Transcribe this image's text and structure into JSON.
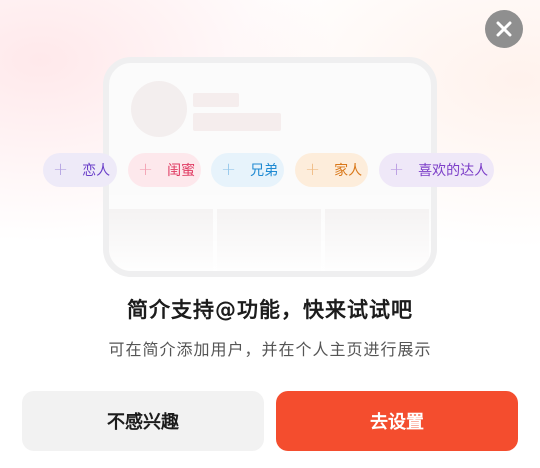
{
  "tags": [
    {
      "plus": "+",
      "label": "恋人"
    },
    {
      "plus": "+",
      "label": "闺蜜"
    },
    {
      "plus": "+",
      "label": "兄弟"
    },
    {
      "plus": "+",
      "label": "家人"
    },
    {
      "plus": "+",
      "label": "喜欢的达人"
    }
  ],
  "title": "简介支持@功能，快来试试吧",
  "subtitle": "可在简介添加用户，并在个人主页进行展示",
  "buttons": {
    "secondary_label": "不感兴趣",
    "primary_label": "去设置"
  },
  "colors": {
    "primary": "#f44d2e",
    "secondary_bg": "#f2f2f2",
    "close_bg": "#8f8f8f"
  },
  "icons": {
    "close": "close-icon"
  }
}
